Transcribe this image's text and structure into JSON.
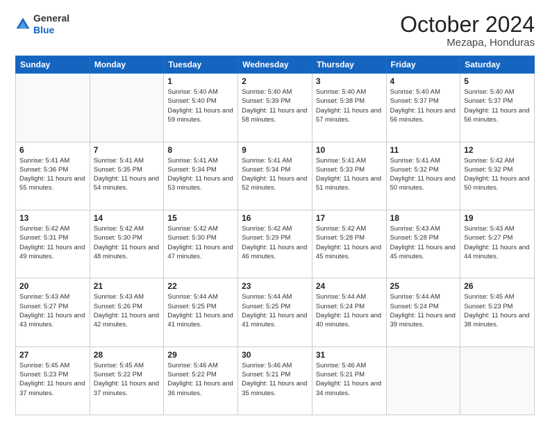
{
  "header": {
    "logo": {
      "line1": "General",
      "line2": "Blue"
    },
    "title": "October 2024",
    "location": "Mezapa, Honduras"
  },
  "weekdays": [
    "Sunday",
    "Monday",
    "Tuesday",
    "Wednesday",
    "Thursday",
    "Friday",
    "Saturday"
  ],
  "weeks": [
    [
      {
        "day": "",
        "info": ""
      },
      {
        "day": "",
        "info": ""
      },
      {
        "day": "1",
        "info": "Sunrise: 5:40 AM\nSunset: 5:40 PM\nDaylight: 11 hours and 59 minutes."
      },
      {
        "day": "2",
        "info": "Sunrise: 5:40 AM\nSunset: 5:39 PM\nDaylight: 11 hours and 58 minutes."
      },
      {
        "day": "3",
        "info": "Sunrise: 5:40 AM\nSunset: 5:38 PM\nDaylight: 11 hours and 57 minutes."
      },
      {
        "day": "4",
        "info": "Sunrise: 5:40 AM\nSunset: 5:37 PM\nDaylight: 11 hours and 56 minutes."
      },
      {
        "day": "5",
        "info": "Sunrise: 5:40 AM\nSunset: 5:37 PM\nDaylight: 11 hours and 56 minutes."
      }
    ],
    [
      {
        "day": "6",
        "info": "Sunrise: 5:41 AM\nSunset: 5:36 PM\nDaylight: 11 hours and 55 minutes."
      },
      {
        "day": "7",
        "info": "Sunrise: 5:41 AM\nSunset: 5:35 PM\nDaylight: 11 hours and 54 minutes."
      },
      {
        "day": "8",
        "info": "Sunrise: 5:41 AM\nSunset: 5:34 PM\nDaylight: 11 hours and 53 minutes."
      },
      {
        "day": "9",
        "info": "Sunrise: 5:41 AM\nSunset: 5:34 PM\nDaylight: 11 hours and 52 minutes."
      },
      {
        "day": "10",
        "info": "Sunrise: 5:41 AM\nSunset: 5:33 PM\nDaylight: 11 hours and 51 minutes."
      },
      {
        "day": "11",
        "info": "Sunrise: 5:41 AM\nSunset: 5:32 PM\nDaylight: 11 hours and 50 minutes."
      },
      {
        "day": "12",
        "info": "Sunrise: 5:42 AM\nSunset: 5:32 PM\nDaylight: 11 hours and 50 minutes."
      }
    ],
    [
      {
        "day": "13",
        "info": "Sunrise: 5:42 AM\nSunset: 5:31 PM\nDaylight: 11 hours and 49 minutes."
      },
      {
        "day": "14",
        "info": "Sunrise: 5:42 AM\nSunset: 5:30 PM\nDaylight: 11 hours and 48 minutes."
      },
      {
        "day": "15",
        "info": "Sunrise: 5:42 AM\nSunset: 5:30 PM\nDaylight: 11 hours and 47 minutes."
      },
      {
        "day": "16",
        "info": "Sunrise: 5:42 AM\nSunset: 5:29 PM\nDaylight: 11 hours and 46 minutes."
      },
      {
        "day": "17",
        "info": "Sunrise: 5:42 AM\nSunset: 5:28 PM\nDaylight: 11 hours and 45 minutes."
      },
      {
        "day": "18",
        "info": "Sunrise: 5:43 AM\nSunset: 5:28 PM\nDaylight: 11 hours and 45 minutes."
      },
      {
        "day": "19",
        "info": "Sunrise: 5:43 AM\nSunset: 5:27 PM\nDaylight: 11 hours and 44 minutes."
      }
    ],
    [
      {
        "day": "20",
        "info": "Sunrise: 5:43 AM\nSunset: 5:27 PM\nDaylight: 11 hours and 43 minutes."
      },
      {
        "day": "21",
        "info": "Sunrise: 5:43 AM\nSunset: 5:26 PM\nDaylight: 11 hours and 42 minutes."
      },
      {
        "day": "22",
        "info": "Sunrise: 5:44 AM\nSunset: 5:25 PM\nDaylight: 11 hours and 41 minutes."
      },
      {
        "day": "23",
        "info": "Sunrise: 5:44 AM\nSunset: 5:25 PM\nDaylight: 11 hours and 41 minutes."
      },
      {
        "day": "24",
        "info": "Sunrise: 5:44 AM\nSunset: 5:24 PM\nDaylight: 11 hours and 40 minutes."
      },
      {
        "day": "25",
        "info": "Sunrise: 5:44 AM\nSunset: 5:24 PM\nDaylight: 11 hours and 39 minutes."
      },
      {
        "day": "26",
        "info": "Sunrise: 5:45 AM\nSunset: 5:23 PM\nDaylight: 11 hours and 38 minutes."
      }
    ],
    [
      {
        "day": "27",
        "info": "Sunrise: 5:45 AM\nSunset: 5:23 PM\nDaylight: 11 hours and 37 minutes."
      },
      {
        "day": "28",
        "info": "Sunrise: 5:45 AM\nSunset: 5:22 PM\nDaylight: 11 hours and 37 minutes."
      },
      {
        "day": "29",
        "info": "Sunrise: 5:46 AM\nSunset: 5:22 PM\nDaylight: 11 hours and 36 minutes."
      },
      {
        "day": "30",
        "info": "Sunrise: 5:46 AM\nSunset: 5:21 PM\nDaylight: 11 hours and 35 minutes."
      },
      {
        "day": "31",
        "info": "Sunrise: 5:46 AM\nSunset: 5:21 PM\nDaylight: 11 hours and 34 minutes."
      },
      {
        "day": "",
        "info": ""
      },
      {
        "day": "",
        "info": ""
      }
    ]
  ]
}
